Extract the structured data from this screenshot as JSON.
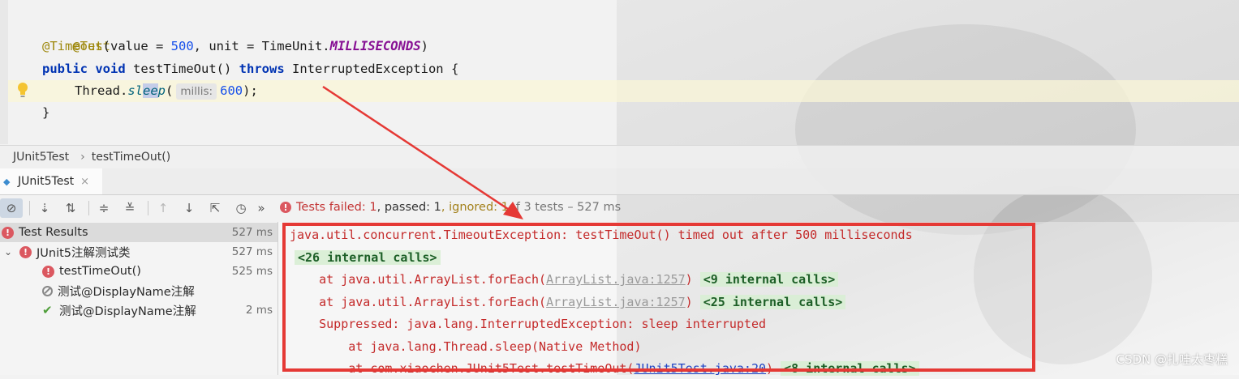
{
  "editor": {
    "line1_annotation": "@Test",
    "line2": {
      "annotation": "@Timeout",
      "open": "(value = ",
      "value": "500",
      "mid": ", unit = TimeUnit.",
      "constant": "MILLISECONDS",
      "close": ")"
    },
    "line3": {
      "kw1": "public",
      "kw2": "void",
      "method": " testTimeOut() ",
      "kw3": "throws",
      "rest": " InterruptedException {"
    },
    "line4": {
      "prefix": "Thread.",
      "method_a": "sl",
      "method_b": "ee",
      "method_c": "p",
      "open": "(",
      "hint": "millis:",
      "value": "600",
      "close": ");"
    },
    "line5": "}"
  },
  "breadcrumb": {
    "items": [
      "JUnit5Test",
      "testTimeOut()"
    ]
  },
  "run_tab": {
    "label": "JUnit5Test",
    "close": "×"
  },
  "toolbar": {
    "icons": [
      "stop-icon",
      "sort-alpha-icon",
      "sort-duration-icon",
      "expand-all-icon",
      "collapse-all-icon",
      "prev-failed-icon",
      "next-failed-icon",
      "export-icon",
      "history-icon",
      "more-icon"
    ]
  },
  "status": {
    "failed": "Tests failed: 1",
    "passed": ", passed: 1",
    "ignored": ", ignored: 1",
    "of_tests": " of 3 tests – 527 ms"
  },
  "tree": {
    "rows": [
      {
        "label": "Test Results",
        "time": "527 ms",
        "status": "error"
      },
      {
        "label": "JUnit5注解测试类",
        "time": "527 ms",
        "status": "error"
      },
      {
        "label": "testTimeOut()",
        "time": "525 ms",
        "status": "error"
      },
      {
        "label": "测试@DisplayName注解",
        "time": "",
        "status": "ignored"
      },
      {
        "label": "测试@DisplayName注解",
        "time": "2 ms",
        "status": "passed"
      }
    ]
  },
  "console": {
    "line1": "java.util.concurrent.TimeoutException: testTimeOut() timed out after 500 milliseconds",
    "line2_internal": "<26 internal calls>",
    "line3": {
      "prefix": "    at java.util.ArrayList.forEach(",
      "link": "ArrayList.java:1257",
      "suffix": ") ",
      "internal": "<9 internal calls>"
    },
    "line4": {
      "prefix": "    at java.util.ArrayList.forEach(",
      "link": "ArrayList.java:1257",
      "suffix": ") ",
      "internal": "<25 internal calls>"
    },
    "line5": "    Suppressed: java.lang.InterruptedException: sleep interrupted",
    "line6": "        at java.lang.Thread.sleep(Native Method)",
    "line7": {
      "prefix": "        at com.xiaochen.JUnit5Test.testTimeOut(",
      "link": "JUnit5Test.java:20",
      "suffix": ") ",
      "internal": "<8 internal calls>"
    }
  },
  "watermark": "CSDN @扎哇太枣糕",
  "colors": {
    "highlight_box": "#e53935",
    "error": "#db5860",
    "ok": "#4f9e3a"
  }
}
